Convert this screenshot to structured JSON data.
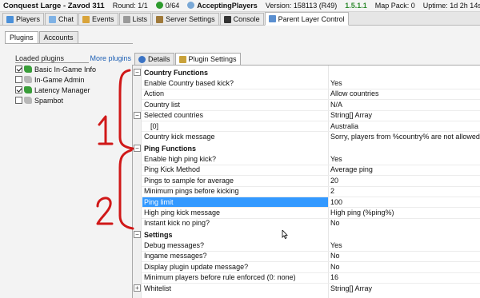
{
  "status": {
    "server_name": "Conquest Large - Zavod 311",
    "round": "Round: 1/1",
    "players": "0/64",
    "state": "AcceptingPlayers",
    "version": "Version: 158113 (R49)",
    "build": "1.5.1.1",
    "map_pack": "Map Pack: 0",
    "uptime": "Uptime: 1d 2h 14s"
  },
  "top_tabs": [
    {
      "label": "Players",
      "icon": "players-icon",
      "color": "#4a90d9"
    },
    {
      "label": "Chat",
      "icon": "chat-icon",
      "color": "#7fb2e5"
    },
    {
      "label": "Events",
      "icon": "events-icon",
      "color": "#d9a43a"
    },
    {
      "label": "Lists",
      "icon": "lists-icon",
      "color": "#9a9a9a"
    },
    {
      "label": "Server Settings",
      "icon": "server-settings-icon",
      "color": "#a07a3a"
    },
    {
      "label": "Console",
      "icon": "console-icon",
      "color": "#333333"
    },
    {
      "label": "Parent Layer Control",
      "icon": "parent-layer-icon",
      "color": "#5a8fd0"
    }
  ],
  "sub_tabs": [
    {
      "label": "Plugins"
    },
    {
      "label": "Accounts"
    }
  ],
  "loaded_plugins": {
    "title": "Loaded plugins",
    "more_link": "More plugins",
    "items": [
      {
        "label": "Basic In-Game Info",
        "checked": true,
        "icon": "puzzle-green-icon"
      },
      {
        "label": "In-Game Admin",
        "checked": false,
        "icon": "puzzle-gray-icon"
      },
      {
        "label": "Latency Manager",
        "checked": true,
        "icon": "puzzle-green-icon"
      },
      {
        "label": "Spambot",
        "checked": false,
        "icon": "puzzle-gray-icon"
      }
    ]
  },
  "right_tabs": [
    {
      "label": "Details",
      "icon": "info-icon"
    },
    {
      "label": "Plugin Settings",
      "icon": "plugin-settings-icon"
    }
  ],
  "settings": {
    "country_header": "Country Functions",
    "c0n": "Enable Country based kick?",
    "c0v": "Yes",
    "c1n": "Action",
    "c1v": "Allow countries",
    "c2n": "Country list",
    "c2v": "N/A",
    "c3n": "Selected countries",
    "c3v": "String[] Array",
    "c4n": "[0]",
    "c4v": "Australia",
    "c5n": "Country kick message",
    "c5v": "Sorry, players from %country% are not allowed.",
    "ping_header": "Ping Functions",
    "p0n": "Enable high ping kick?",
    "p0v": "Yes",
    "p1n": "Ping Kick Method",
    "p1v": "Average ping",
    "p2n": "Pings to sample for average",
    "p2v": "20",
    "p3n": "Minimum pings before kicking",
    "p3v": "2",
    "p4n": "Ping limit",
    "p4v": "100",
    "p5n": "High ping kick message",
    "p5v": "High ping (%ping%)",
    "p6n": "Instant kick no ping?",
    "p6v": "No",
    "settings_header": "Settings",
    "s0n": "Debug messages?",
    "s0v": "Yes",
    "s1n": "Ingame messages?",
    "s1v": "No",
    "s2n": "Display plugin update message?",
    "s2v": "No",
    "s3n": "Minimum players before rule enforced (0: none)",
    "s3v": "16",
    "s4n": "Whitelist",
    "s4v": "String[] Array"
  },
  "colors": {
    "selection": "#3399ff",
    "online_dot": "#2e9b2e",
    "link": "#1d5fb4"
  }
}
